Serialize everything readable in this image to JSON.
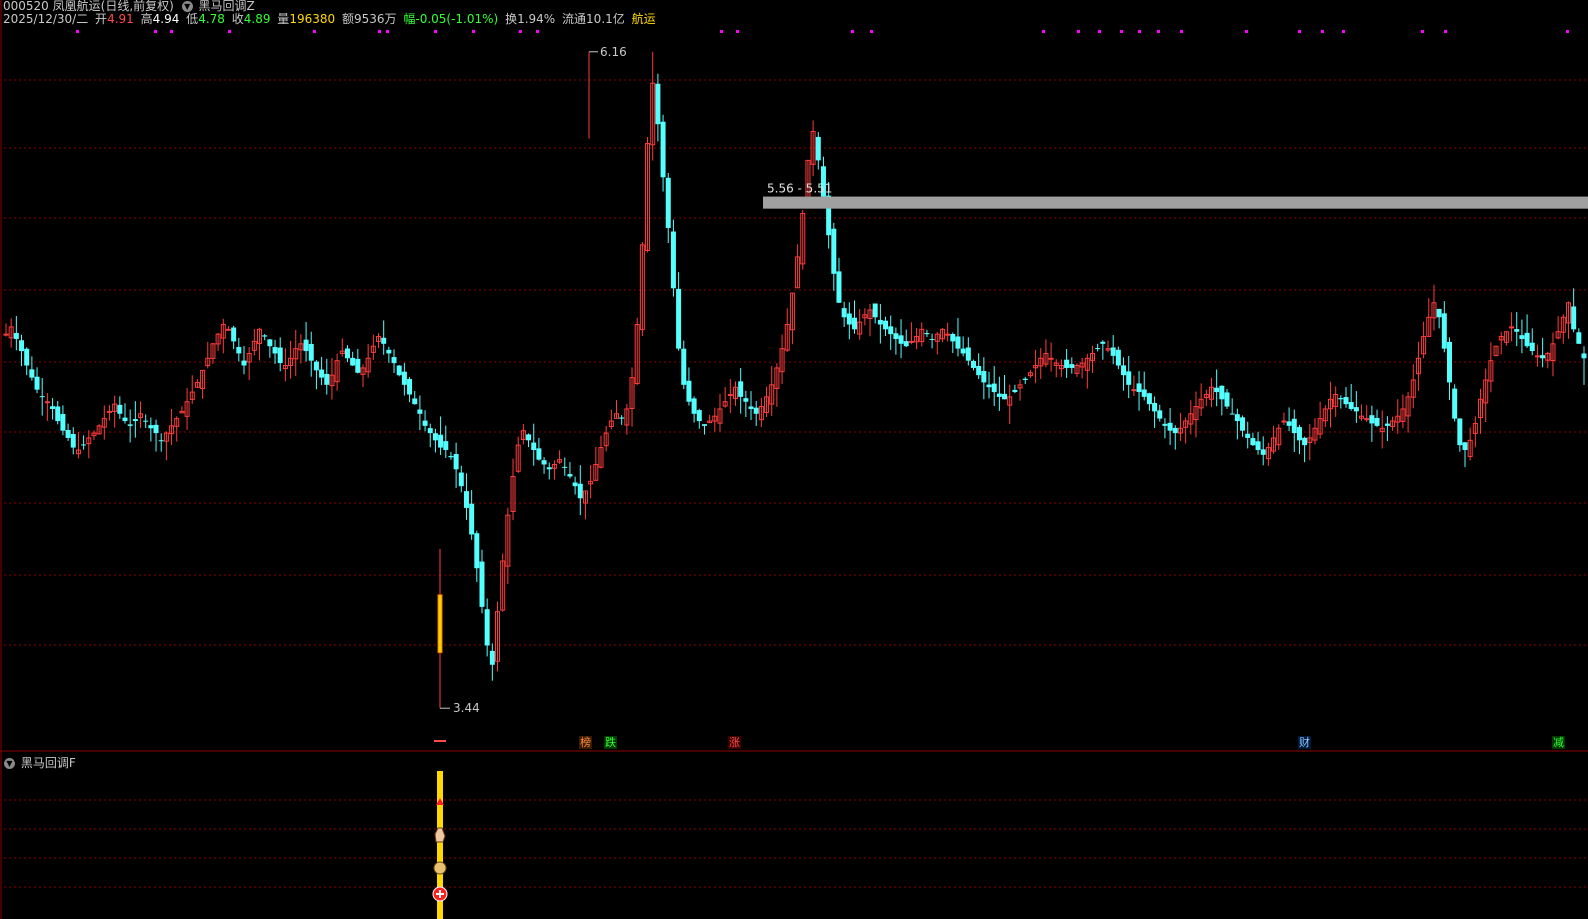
{
  "header": {
    "code": "000520",
    "name": "凤凰航运",
    "period": "(日线,前复权)",
    "indicator": "黑马回调Z",
    "date": "2025/12/30/二",
    "open_label": "开",
    "open": "4.91",
    "high_label": "高",
    "high": "4.94",
    "low_label": "低",
    "low": "4.78",
    "close_label": "收",
    "close": "4.89",
    "volume_label": "量",
    "volume": "196380",
    "amount_label": "额",
    "amount": "9536万",
    "change_label": "幅",
    "change": "-0.05(-1.01%)",
    "turnover_label": "换",
    "turnover": "1.94%",
    "float_label": "流通",
    "float": "10.1亿",
    "sector": "航运"
  },
  "annotations": {
    "peak": "6.16",
    "trough": "3.44",
    "zone": "5.56 - 5.51"
  },
  "event_tags": [
    "榜",
    "跌",
    "涨",
    "财",
    "减"
  ],
  "sub_panel": {
    "title": "黑马回调F"
  },
  "colors": {
    "up": "#ff3c3c",
    "down": "#54ffff",
    "grid": "#8b0000",
    "zone": "#a0a0a0",
    "marker": "#ff00ff",
    "signal": "#ffd800"
  },
  "chart_data": {
    "type": "candlestick",
    "title": "凤凰航运",
    "x_range": "end 2025/12/30",
    "ylim": [
      3.3,
      6.3
    ],
    "peak": 6.16,
    "trough": 3.44,
    "zone": [
      5.51,
      5.56
    ],
    "last": {
      "open": 4.91,
      "high": 4.94,
      "low": 4.78,
      "close": 4.89
    },
    "closes": [
      4.99,
      5.02,
      4.97,
      4.92,
      4.86,
      4.81,
      4.76,
      4.73,
      4.71,
      4.68,
      4.63,
      4.59,
      4.56,
      4.52,
      4.51,
      4.53,
      4.56,
      4.58,
      4.61,
      4.64,
      4.67,
      4.7,
      4.66,
      4.63,
      4.61,
      4.63,
      4.66,
      4.63,
      4.6,
      4.58,
      4.55,
      4.58,
      4.61,
      4.64,
      4.67,
      4.71,
      4.75,
      4.79,
      4.84,
      4.89,
      4.95,
      4.99,
      5.03,
      5.01,
      4.96,
      4.91,
      4.86,
      4.91,
      4.96,
      5.01,
      4.98,
      4.94,
      4.91,
      4.87,
      4.86,
      4.89,
      4.93,
      4.95,
      4.92,
      4.88,
      4.84,
      4.81,
      4.78,
      4.82,
      4.88,
      4.92,
      4.89,
      4.86,
      4.83,
      4.85,
      4.89,
      4.94,
      4.98,
      4.95,
      4.91,
      4.87,
      4.82,
      4.78,
      4.74,
      4.7,
      4.66,
      4.61,
      4.58,
      4.55,
      4.52,
      4.51,
      4.48,
      4.43,
      4.36,
      4.27,
      4.16,
      4.02,
      3.86,
      3.7,
      3.62,
      3.84,
      4.05,
      4.24,
      4.4,
      4.53,
      4.59,
      4.55,
      4.51,
      4.47,
      4.45,
      4.43,
      4.45,
      4.47,
      4.44,
      4.4,
      4.36,
      4.31,
      4.34,
      4.38,
      4.45,
      4.52,
      4.58,
      4.63,
      4.66,
      4.64,
      4.68,
      4.81,
      5.03,
      5.36,
      5.78,
      6.03,
      5.86,
      5.64,
      5.43,
      5.18,
      4.93,
      4.78,
      4.71,
      4.66,
      4.63,
      4.61,
      4.63,
      4.65,
      4.68,
      4.71,
      4.74,
      4.77,
      4.73,
      4.71,
      4.68,
      4.66,
      4.69,
      4.73,
      4.78,
      4.85,
      4.93,
      5.03,
      5.16,
      5.31,
      5.49,
      5.71,
      5.83,
      5.71,
      5.56,
      5.4,
      5.24,
      5.12,
      5.06,
      5.03,
      5.01,
      5.04,
      5.07,
      5.09,
      5.06,
      5.03,
      5.01,
      4.99,
      4.97,
      4.95,
      4.94,
      4.96,
      4.98,
      5.01,
      4.99,
      4.97,
      4.99,
      5.01,
      4.99,
      4.96,
      4.93,
      4.91,
      4.88,
      4.85,
      4.82,
      4.79,
      4.77,
      4.75,
      4.73,
      4.72,
      4.73,
      4.75,
      4.78,
      4.8,
      4.83,
      4.86,
      4.89,
      4.91,
      4.89,
      4.87,
      4.86,
      4.85,
      4.85,
      4.86,
      4.87,
      4.89,
      4.91,
      4.93,
      4.95,
      4.93,
      4.9,
      4.86,
      4.82,
      4.78,
      4.76,
      4.75,
      4.73,
      4.7,
      4.67,
      4.64,
      4.61,
      4.59,
      4.58,
      4.6,
      4.63,
      4.66,
      4.69,
      4.72,
      4.74,
      4.77,
      4.75,
      4.72,
      4.69,
      4.66,
      4.63,
      4.59,
      4.56,
      4.53,
      4.51,
      4.49,
      4.52,
      4.56,
      4.6,
      4.63,
      4.61,
      4.58,
      4.55,
      4.53,
      4.56,
      4.6,
      4.64,
      4.68,
      4.72,
      4.74,
      4.72,
      4.7,
      4.68,
      4.67,
      4.65,
      4.64,
      4.62,
      4.61,
      4.6,
      4.61,
      4.63,
      4.65,
      4.68,
      4.73,
      4.8,
      4.89,
      4.98,
      5.06,
      5.12,
      5.06,
      4.93,
      4.79,
      4.64,
      4.53,
      4.51,
      4.55,
      4.62,
      4.72,
      4.8,
      4.88,
      4.94,
      4.98,
      5.0,
      5.02,
      5.0,
      4.97,
      4.94,
      4.92,
      4.9,
      4.89,
      4.91,
      4.95,
      5.0,
      5.06,
      5.12,
      5.01,
      4.95,
      4.89
    ]
  }
}
